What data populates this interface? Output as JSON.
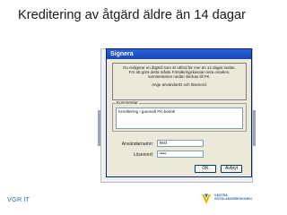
{
  "slide": {
    "title": "Kreditering av åtgärd äldre än 14 dagar",
    "footer_left": "VGR IT"
  },
  "dialog": {
    "title": "Signera",
    "info_lines": [
      "Du redigerar en åtgärd som är utförd för mer än 14 dagar sedan.",
      "För att göra detta måste Försäkringskassan veta orsaken,",
      "kommentaren nedan skickas till FK.",
      "Ange användarID och lösenord."
    ],
    "comment_label": "Kommentar",
    "comment_value": "Kreditering i ganmalt FK-besök",
    "username_label": "Användarnamn:",
    "username_value": "test",
    "password_label": "Lösenord:",
    "password_value": "••••",
    "ok_label": "OK",
    "cancel_label": "Avbryt"
  },
  "logo": {
    "line1": "VÄSTRA",
    "line2": "GÖTALANDSREGIONEN",
    "color": "#2d6cb3",
    "accent": "#f0b400"
  }
}
